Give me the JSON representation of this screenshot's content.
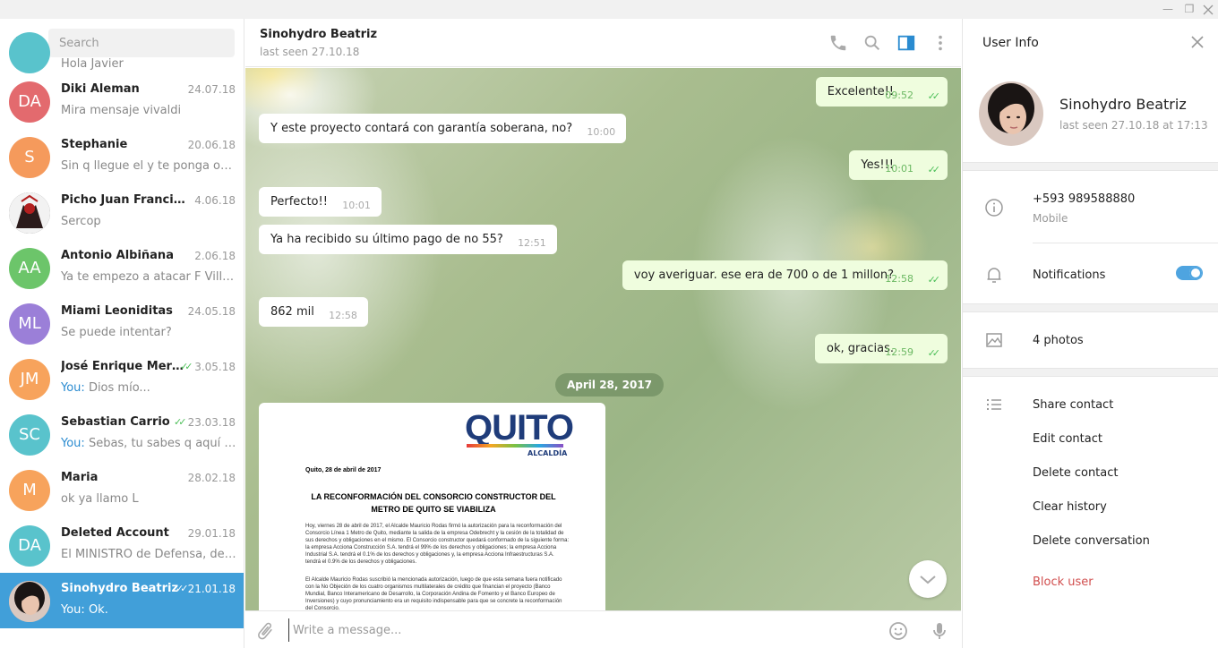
{
  "window": {
    "minimize_glyph": "—",
    "maximize_glyph": "❐"
  },
  "sidebar": {
    "search_placeholder": "Search",
    "partial_top_preview": "Hola Javier",
    "chats": [
      {
        "name": "Diki Aleman",
        "date": "24.07.18",
        "preview": "Mira mensaje vivaldi",
        "initials": "DA",
        "color": "#e36a6e",
        "you": "",
        "read": false
      },
      {
        "name": "Stephanie",
        "date": "20.06.18",
        "preview": "Sin q llegue el y te ponga obstá...",
        "initials": "S",
        "color": "#f59a5c",
        "you": "",
        "read": false
      },
      {
        "name": "Picho Juan Francisco",
        "date": "4.06.18",
        "preview": "Sercop",
        "initials": "",
        "color": "#444444",
        "you": "",
        "read": false
      },
      {
        "name": "Antonio Albiñana",
        "date": "2.06.18",
        "preview": "Ya te empezo a atacar F Vill con...",
        "initials": "AA",
        "color": "#6cc56a",
        "you": "",
        "read": false
      },
      {
        "name": "Miami Leoniditas",
        "date": "24.05.18",
        "preview": "Se puede intentar?",
        "initials": "ML",
        "color": "#9b7fd8",
        "you": "",
        "read": false
      },
      {
        "name": "José Enrique Merc...",
        "date": "3.05.18",
        "preview": "Dios mío...",
        "initials": "JM",
        "color": "#f7a35c",
        "you": "You:",
        "read": true
      },
      {
        "name": "Sebastian Carrio",
        "date": "23.03.18",
        "preview": "Sebas, tu sabes q aquí te q...",
        "initials": "SC",
        "color": "#59c3cc",
        "you": "You:",
        "read": true
      },
      {
        "name": "Maria",
        "date": "28.02.18",
        "preview": "ok ya llamo L",
        "initials": "M",
        "color": "#f7a35c",
        "you": "",
        "read": false
      },
      {
        "name": "Deleted Account",
        "date": "29.01.18",
        "preview": "El MINISTRO de Defensa, defini...",
        "initials": "DA",
        "color": "#59c3cc",
        "you": "",
        "read": false
      },
      {
        "name": "Sinohydro Beatriz",
        "date": "21.01.18",
        "preview": "Ok.",
        "initials": "",
        "color": "#ccaa99",
        "you": "You:",
        "read": true
      }
    ]
  },
  "chat": {
    "peer_name": "Sinohydro Beatriz",
    "peer_status": "last seen 27.10.18",
    "messages": [
      {
        "dir": "out",
        "text": "Excelente!!",
        "time": "09:52"
      },
      {
        "dir": "in",
        "text": "Y este proyecto contará con garantía soberana, no?",
        "time": "10:00"
      },
      {
        "dir": "out",
        "text": "Yes!!!",
        "time": "10:01"
      },
      {
        "dir": "in",
        "text": "Perfecto!!",
        "time": "10:01"
      },
      {
        "dir": "in",
        "text": "Ya ha recibido su último pago de no 55?",
        "time": "12:51"
      },
      {
        "dir": "out",
        "text": "voy averiguar. ese era de 700 o de 1 millon?",
        "time": "12:58"
      },
      {
        "dir": "in",
        "text": "862 mil",
        "time": "12:58"
      },
      {
        "dir": "out",
        "text": "ok, gracias.",
        "time": "12:59"
      }
    ],
    "date_separator": "April 28, 2017",
    "document": {
      "logo": "QUITO",
      "logo_sub": "ALCALDÍA",
      "date_line": "Quito, 28 de abril de 2017",
      "title": "LA RECONFORMACIÓN DEL CONSORCIO CONSTRUCTOR DEL METRO DE QUITO SE VIABILIZA",
      "paragraph1": "Hoy, viernes 28 de abril de 2017, el Alcalde Mauricio Rodas firmó la autorización para la reconformación del Consorcio Línea 1 Metro de Quito, mediante la salida de la empresa Odebrecht y la cesión de la totalidad de sus derechos y obligaciones en el mismo. El Consorcio constructor quedará conformado de la siguiente forma: la empresa Acciona Construcción S.A. tendrá el 99% de los derechos y obligaciones; la empresa Acciona Industrial S.A. tendrá el 0.1% de los derechos y obligaciones y, la empresa Acciona Infraestructuras S.A. tendrá el 0.9% de los derechos y obligaciones.",
      "paragraph2": "El Alcalde Mauricio Rodas suscribió la mencionada autorización, luego de que esta semana fuera notificado con la No Objeción de los cuatro organismos multilaterales de crédito que financian el proyecto (Banco Mundial, Banco Interamericano de Desarrollo, la Corporación Andina de Fomento y el Banco Europeo de Inversiones) y cuyo pronunciamiento era un requisito indispensable para que se concrete la reconformación del Consorcio."
    },
    "composer_placeholder": "Write a message..."
  },
  "user_info": {
    "title": "User Info",
    "name": "Sinohydro Beatriz",
    "last_seen": "last seen 27.10.18 at 17:13",
    "phone": "+593 989588880",
    "phone_label": "Mobile",
    "notifications_label": "Notifications",
    "notifications_on": true,
    "photos": "4 photos",
    "actions": {
      "share": "Share contact",
      "edit": "Edit contact",
      "delete": "Delete contact",
      "clear": "Clear history",
      "delete_conv": "Delete conversation",
      "block": "Block user"
    }
  },
  "colors": {
    "accent": "#419fd9",
    "out_bubble": "#effdde",
    "read_tick": "#4dbf59",
    "danger": "#d14e4e"
  },
  "icons": [
    "menu-icon",
    "phone-icon",
    "search-icon",
    "sidebar-toggle-icon",
    "more-icon",
    "attach-icon",
    "emoji-icon",
    "mic-icon",
    "close-icon",
    "info-icon",
    "bell-icon",
    "photo-icon",
    "list-icon",
    "chevron-down-icon"
  ]
}
